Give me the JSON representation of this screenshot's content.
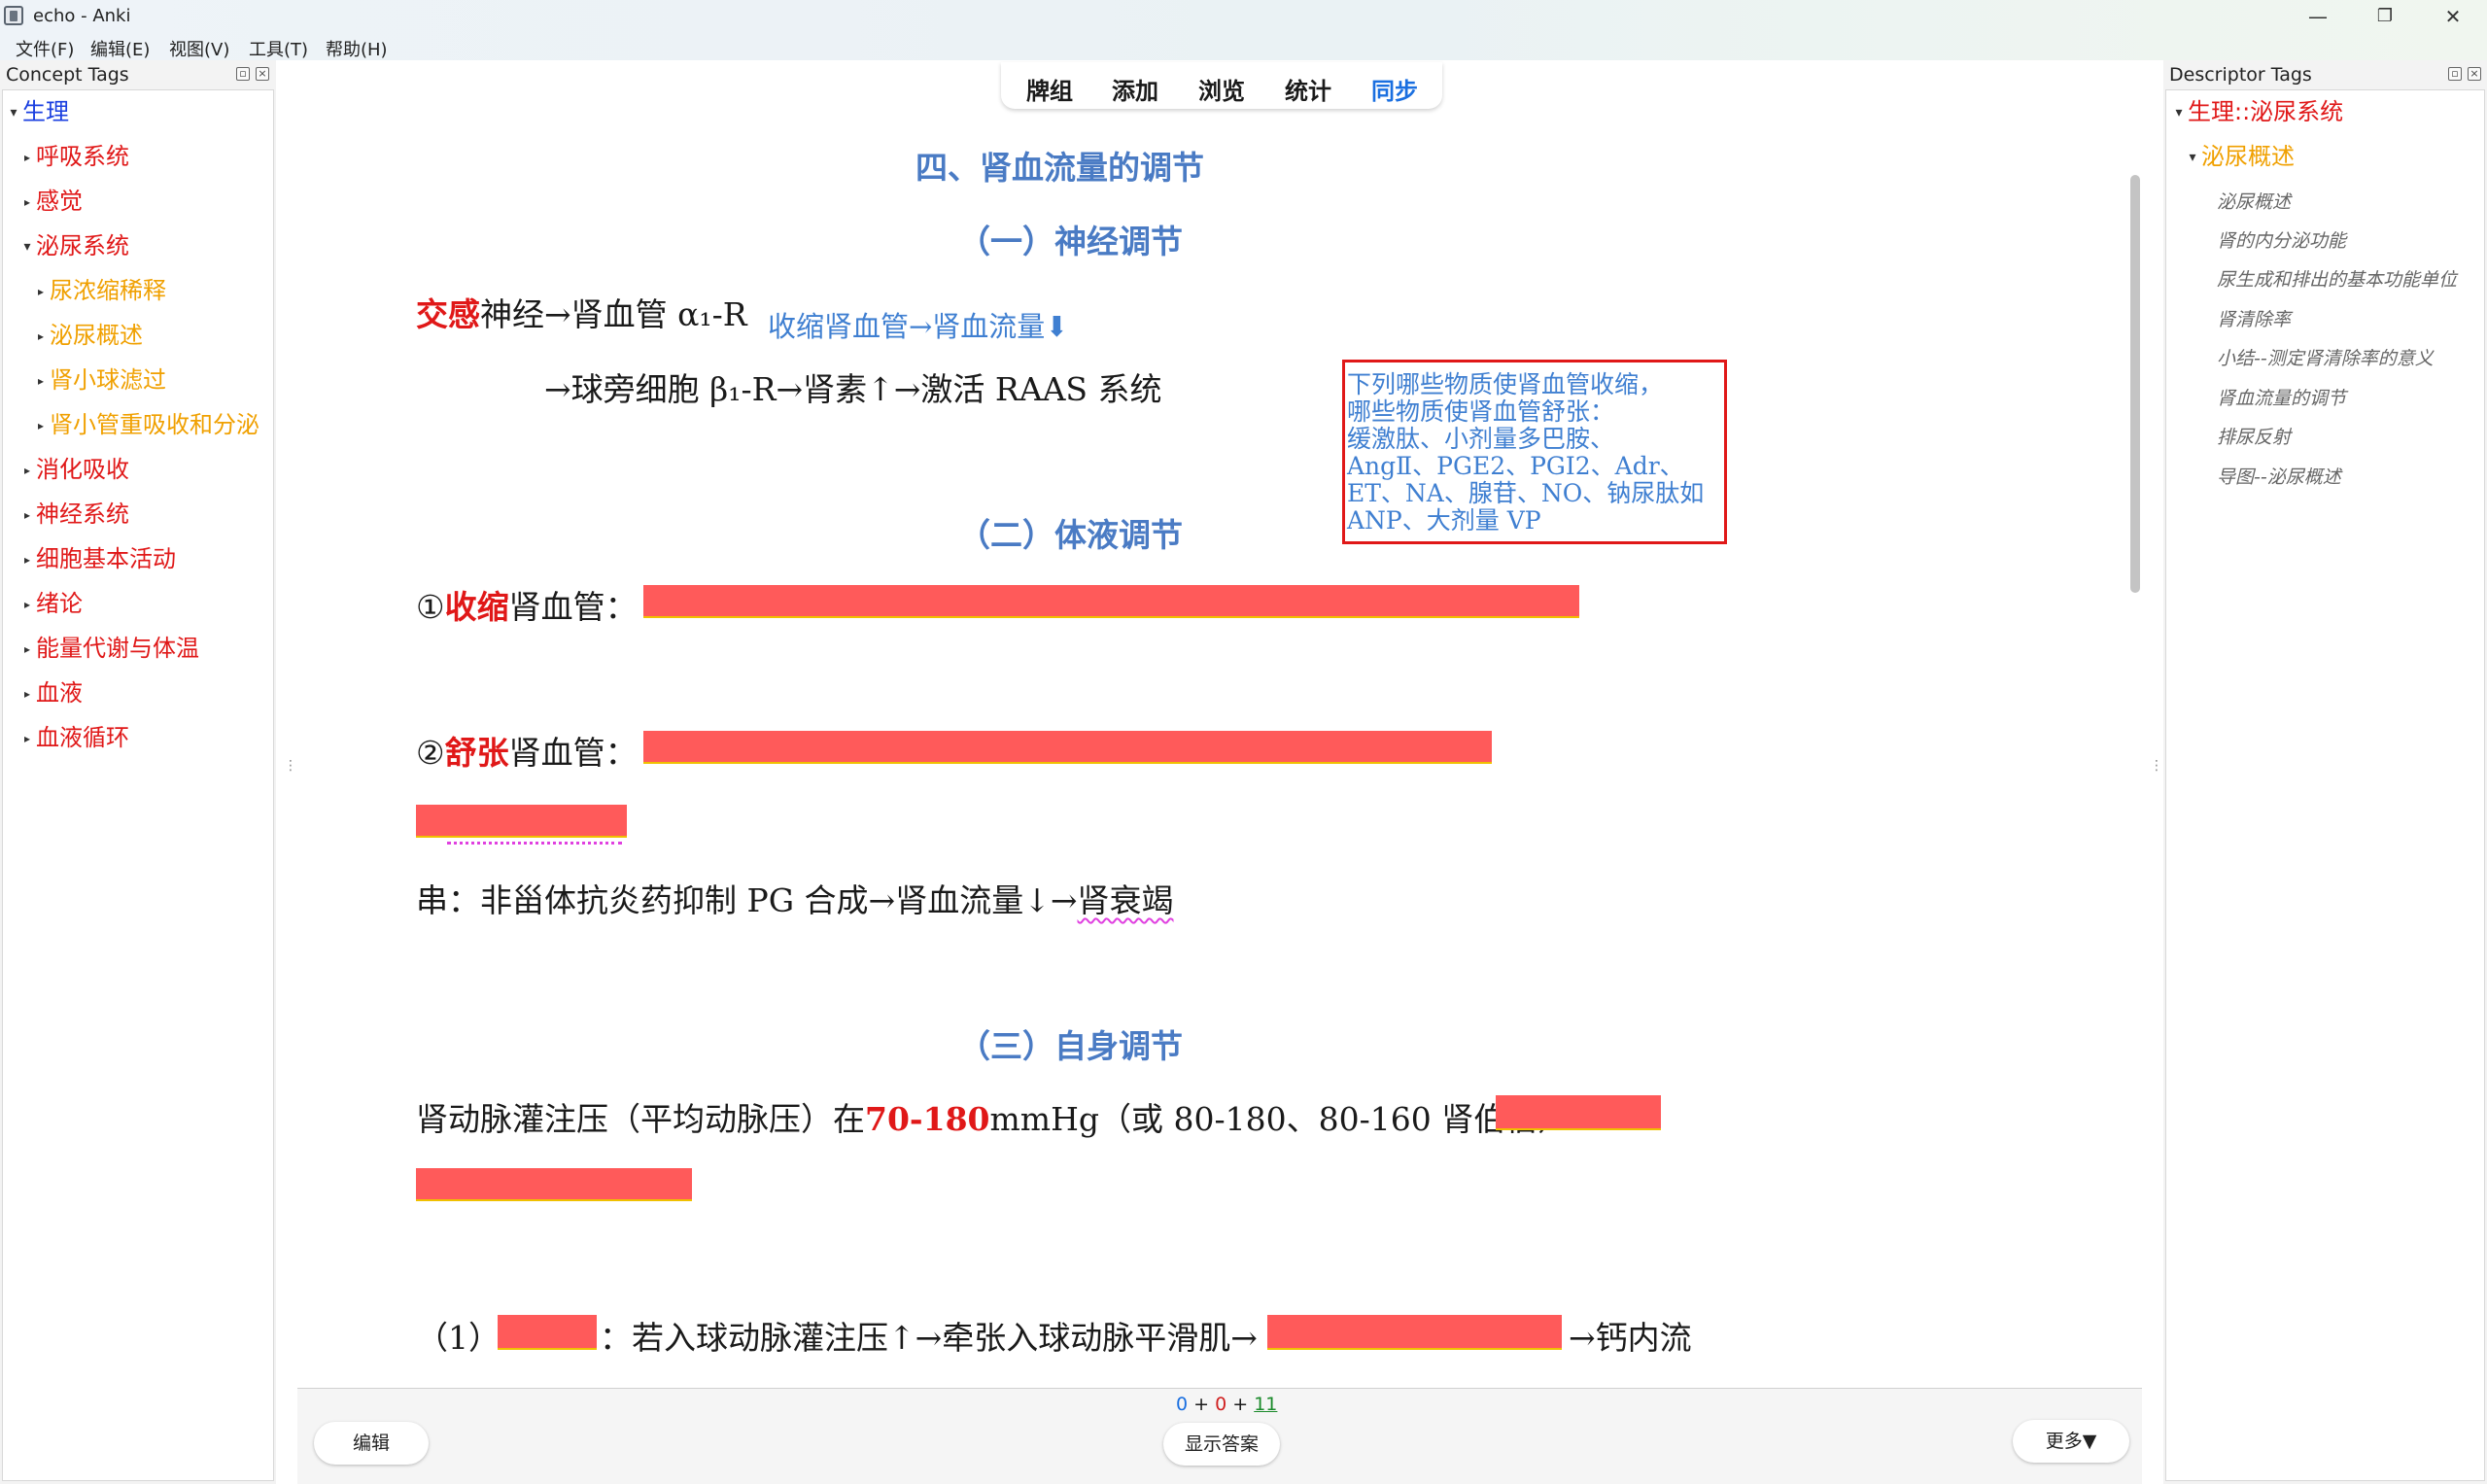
{
  "window": {
    "title": "echo - Anki",
    "minimize": "—",
    "restore": "❐",
    "close": "✕"
  },
  "menu": [
    "文件(F)",
    "编辑(E)",
    "视图(V)",
    "工具(T)",
    "帮助(H)"
  ],
  "left_panel": {
    "title": "Concept Tags",
    "items": [
      {
        "label": "生理",
        "color": "#1a3fe0",
        "expanded": true
      },
      {
        "label": "呼吸系统",
        "color": "#e01818"
      },
      {
        "label": "感觉",
        "color": "#e01818"
      },
      {
        "label": "泌尿系统",
        "color": "#e01818",
        "expanded": true
      },
      {
        "label": "尿浓缩稀释",
        "color": "#f0a000"
      },
      {
        "label": "泌尿概述",
        "color": "#f0a000"
      },
      {
        "label": "肾小球滤过",
        "color": "#f0a000"
      },
      {
        "label": "肾小管重吸收和分泌",
        "color": "#f0a000"
      },
      {
        "label": "消化吸收",
        "color": "#e01818"
      },
      {
        "label": "神经系统",
        "color": "#e01818"
      },
      {
        "label": "细胞基本活动",
        "color": "#e01818"
      },
      {
        "label": "绪论",
        "color": "#e01818"
      },
      {
        "label": "能量代谢与体温",
        "color": "#e01818"
      },
      {
        "label": "血液",
        "color": "#e01818"
      },
      {
        "label": "血液循环",
        "color": "#e01818"
      }
    ]
  },
  "toolbar": {
    "decks": "牌组",
    "add": "添加",
    "browse": "浏览",
    "stats": "统计",
    "sync": "同步"
  },
  "card": {
    "heading_main": "四、肾血流量的调节",
    "heading_1": "（一）神经调节",
    "line1_red": "交感",
    "line1_rest": "神经→肾血管 α₁-R",
    "line1_note": "收缩肾血管→肾血流量⬇",
    "line2": "→球旁细胞 β₁-R→肾素↑→激活 RAAS 系统",
    "heading_2": "（二）体液调节",
    "contract_prefix": "①",
    "contract_red": "收缩",
    "contract_rest": "肾血管：",
    "dilate_prefix": "②",
    "dilate_red": "舒张",
    "dilate_rest": "肾血管：",
    "chuan_line_a": "串：非甾体抗炎药抑制 PG 合成→肾血流量↓→",
    "chuan_line_b": "肾衰竭",
    "heading_3": "（三）自身调节",
    "auto_a": "肾动脉灌注压（平均动脉压）在",
    "auto_red": "70-180",
    "auto_b": "mmHg（或 80-180、80-160 肾伯伯）",
    "item1_prefix": "（1）",
    "item1_mid": "：若入球动脉灌注压↑→牵张入球动脉平滑肌→",
    "item1_end": "→钙内流",
    "note_box": [
      "下列哪些物质使肾血管收缩，",
      "哪些物质使肾血管舒张：",
      "缓激肽、小剂量多巴胺、",
      "AngⅡ、PGE2、PGI2、Adr、",
      "ET、NA、腺苷、NO、钠尿肽如",
      "ANP、大剂量 VP"
    ]
  },
  "bottom": {
    "counts": {
      "new": "0",
      "learn": "0",
      "review": "11",
      "plus": "+"
    },
    "edit": "编辑",
    "show_answer": "显示答案",
    "more": "更多▼"
  },
  "right_panel": {
    "title": "Descriptor Tags",
    "root": "生理::泌尿系统",
    "sub": "泌尿概述",
    "children": [
      "泌尿概述",
      "肾的内分泌功能",
      "尿生成和排出的基本功能单位",
      "肾清除率",
      "小结--测定肾清除率的意义",
      "肾血流量的调节",
      "排尿反射",
      "导图--泌尿概述"
    ]
  },
  "colors": {
    "heading": "#4a7bc4",
    "cloze": "#ff5a5a",
    "accent_red": "#e01818",
    "tag_orange": "#f0a000",
    "tag_blue": "#1a3fe0",
    "note_blue": "#3f7fd1"
  }
}
